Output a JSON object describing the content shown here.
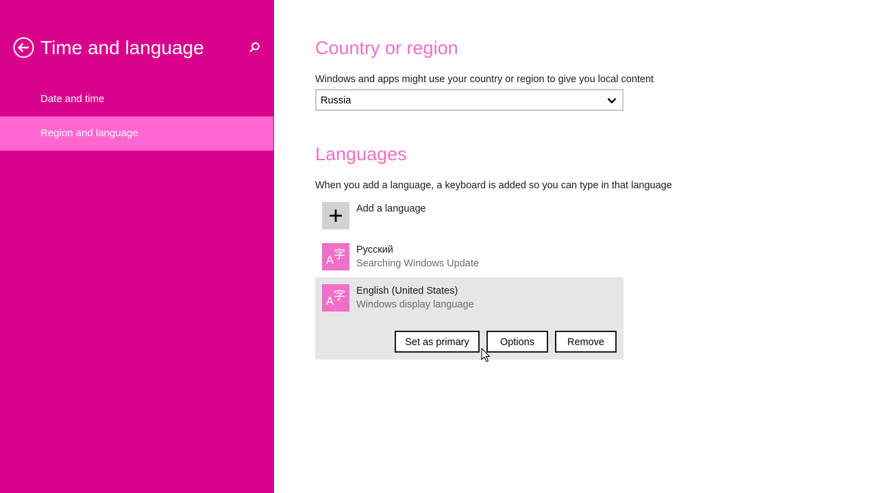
{
  "sidebar": {
    "title": "Time and language",
    "back_icon": "back-arrow-icon",
    "search_icon": "search-icon",
    "items": [
      {
        "label": "Date and time",
        "selected": false
      },
      {
        "label": "Region and language",
        "selected": true
      }
    ],
    "colors": {
      "background": "#d9008c",
      "selected": "#ff66d0"
    }
  },
  "country": {
    "title": "Country or region",
    "description": "Windows and apps might use your country or region to give you local content",
    "selected": "Russia"
  },
  "languages": {
    "title": "Languages",
    "description": "When you add a language, a keyboard is added so you can type in that language",
    "add_label": "Add a language",
    "items": [
      {
        "name": "Русский",
        "status": "Searching Windows Update",
        "icon": "language-icon"
      },
      {
        "name": "English (United States)",
        "status": "Windows display language",
        "icon": "language-icon",
        "expanded": true
      }
    ],
    "actions": {
      "set_primary": "Set as primary",
      "options": "Options",
      "remove": "Remove"
    }
  },
  "colors": {
    "accent": "#f06fc8"
  }
}
